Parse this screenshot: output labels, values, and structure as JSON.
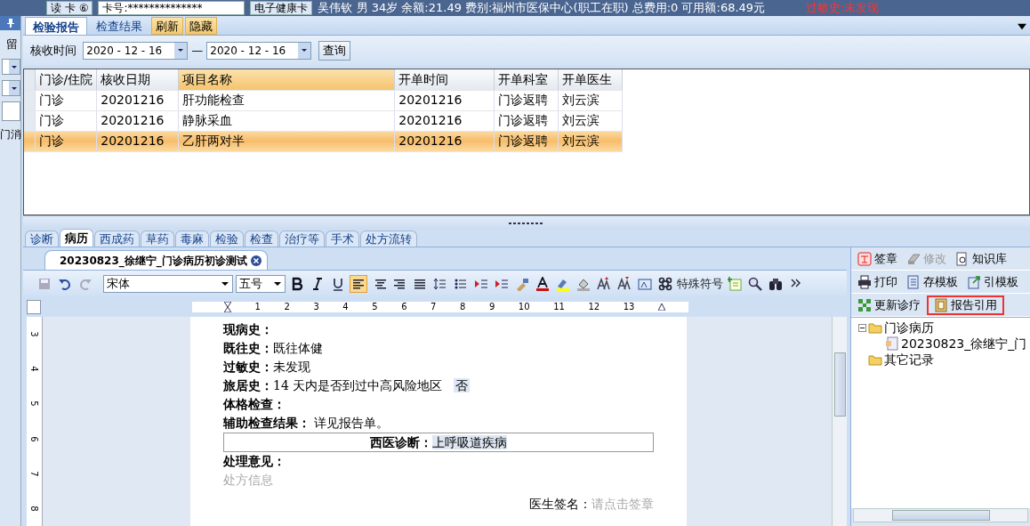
{
  "top_bar": {
    "read_card": "读 卡 ⑥",
    "card_no": "卡号:**************",
    "health_card": "电子健康卡",
    "patient_info": "吴伟钦 男 34岁 余额:21.49 费别:福州市医保中心(职工在职) 总费用:0 可用额:68.49元",
    "allergy": "过敏史:未发现"
  },
  "left_strip": {
    "top_text": "留",
    "bottom_text": "门消"
  },
  "report_panel": {
    "tabs": [
      {
        "label": "检验报告",
        "selected": true
      },
      {
        "label": "检查结果",
        "selected": false
      }
    ],
    "buttons": [
      "刷新",
      "隐藏"
    ],
    "filter": {
      "label": "核收时间",
      "date_from": "2020 - 12 - 16",
      "separator": "—",
      "date_to": "2020 - 12 - 16",
      "query_button": "查询"
    },
    "table": {
      "columns": [
        {
          "label": "门诊/住院",
          "sorted": false
        },
        {
          "label": "核收日期",
          "sorted": false
        },
        {
          "label": "项目名称",
          "sorted": true
        },
        {
          "label": "开单时间",
          "sorted": false
        },
        {
          "label": "开单科室",
          "sorted": false
        },
        {
          "label": "开单医生",
          "sorted": false
        }
      ],
      "rows": [
        {
          "cells": [
            "门诊",
            "20201216",
            "肝功能检查",
            "20201216",
            "门诊返聘",
            "刘云滨"
          ],
          "selected": false
        },
        {
          "cells": [
            "门诊",
            "20201216",
            "静脉采血",
            "20201216",
            "门诊返聘",
            "刘云滨"
          ],
          "selected": false
        },
        {
          "cells": [
            "门诊",
            "20201216",
            "乙肝两对半",
            "20201216",
            "门诊返聘",
            "刘云滨"
          ],
          "selected": true
        }
      ]
    }
  },
  "module_tabs": [
    {
      "label": "诊断",
      "selected": false
    },
    {
      "label": "病历",
      "selected": true
    },
    {
      "label": "西成药",
      "selected": false
    },
    {
      "label": "草药",
      "selected": false
    },
    {
      "label": "毒麻",
      "selected": false
    },
    {
      "label": "检验",
      "selected": false
    },
    {
      "label": "检查",
      "selected": false
    },
    {
      "label": "治疗等",
      "selected": false
    },
    {
      "label": "手术",
      "selected": false
    },
    {
      "label": "处方流转",
      "selected": false
    }
  ],
  "document_tab": {
    "title": "20230823_徐继宁_门诊病历初诊测试"
  },
  "toolbar": {
    "font": "宋体",
    "size": "五号",
    "special_symbols": "特殊符号",
    "align_buttons": [
      {
        "selected": true
      },
      {
        "selected": false
      },
      {
        "selected": false
      },
      {
        "selected": false
      }
    ]
  },
  "ruler_numbers": [
    "1",
    "2",
    "3",
    "4",
    "5",
    "6",
    "7",
    "8",
    "9",
    "10",
    "11",
    "12",
    "13"
  ],
  "vertical_ruler_numbers": [
    "3",
    "4",
    "5",
    "6",
    "7",
    "8"
  ],
  "document": {
    "lines": [
      {
        "kind": "field",
        "label": "现病史："
      },
      {
        "kind": "field",
        "label": "既往史：",
        "value": "既往体健"
      },
      {
        "kind": "field",
        "label": "过敏史：",
        "value": "未发现"
      },
      {
        "kind": "field",
        "label": "旅居史：",
        "value": "14 天内是否到过中高风险地区",
        "answer": "否"
      },
      {
        "kind": "field",
        "label": "体格检查："
      },
      {
        "kind": "field",
        "label": "辅助检查结果：",
        "value": " 详见报告单。"
      },
      {
        "kind": "boxed",
        "label": "西医诊断：",
        "value": "上呼吸道疾病"
      },
      {
        "kind": "field",
        "label": "处理意见："
      },
      {
        "kind": "hint",
        "text": "处方信息"
      },
      {
        "kind": "signature",
        "label": "医生签名：",
        "placeholder": "请点击签章"
      }
    ]
  },
  "side_panel": {
    "buttons": [
      {
        "label": "签章",
        "disabled": false,
        "highlighted": false
      },
      {
        "label": "修改",
        "disabled": true,
        "highlighted": false
      },
      {
        "label": "知识库",
        "disabled": false,
        "highlighted": false
      },
      {
        "label": "打印",
        "disabled": false,
        "highlighted": false
      },
      {
        "label": "存模板",
        "disabled": false,
        "highlighted": false
      },
      {
        "label": "引模板",
        "disabled": false,
        "highlighted": false
      },
      {
        "label": "更新诊疗",
        "disabled": false,
        "highlighted": false
      },
      {
        "label": "报告引用",
        "disabled": false,
        "highlighted": true
      }
    ],
    "tree": [
      {
        "label": "门诊病历",
        "expanded": true,
        "children": [
          {
            "label": "20230823_徐继宁_门"
          }
        ]
      },
      {
        "label": "其它记录"
      }
    ]
  }
}
